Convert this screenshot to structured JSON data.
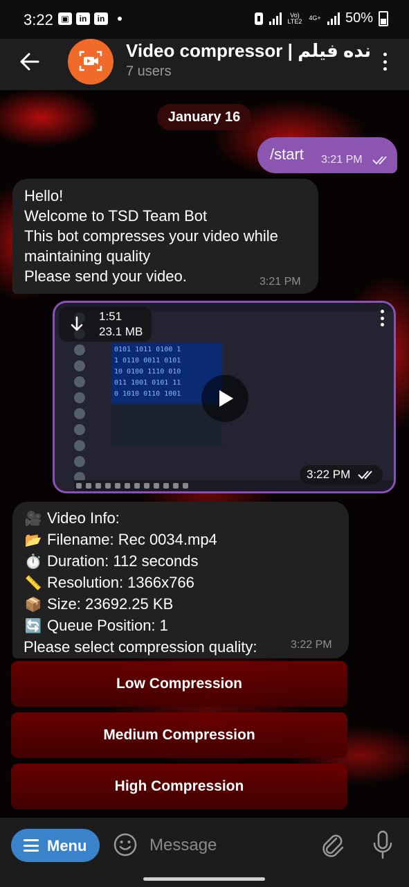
{
  "status_bar": {
    "time": "3:22",
    "network": "Vo) LTE2",
    "network_type": "4G+",
    "battery": "50%"
  },
  "header": {
    "title": "Video compressor | نده فیلم",
    "subtitle": "7 users"
  },
  "chat": {
    "date": "January 16",
    "outgoing": {
      "text": "/start",
      "time": "3:21 PM"
    },
    "welcome": {
      "lines": [
        "Hello!",
        "Welcome to TSD Team Bot",
        "This bot compresses your video while",
        "maintaining quality",
        "Please send your video."
      ],
      "time": "3:21 PM"
    },
    "video": {
      "duration": "1:51",
      "size": "23.1 MB",
      "time": "3:22 PM"
    },
    "info": {
      "rows": [
        {
          "icon": "🎥",
          "text": "Video Info:"
        },
        {
          "icon": "📂",
          "text": "Filename: Rec 0034.mp4"
        },
        {
          "icon": "⏱️",
          "text": "Duration: 112 seconds"
        },
        {
          "icon": "📏",
          "text": "Resolution: 1366x766"
        },
        {
          "icon": "📦",
          "text": "Size: 23692.25 KB"
        },
        {
          "icon": "🔄",
          "text": "Queue Position: 1"
        }
      ],
      "prompt": "Please select compression quality:",
      "time": "3:22 PM"
    }
  },
  "keyboard": {
    "low": "Low Compression",
    "medium": "Medium Compression",
    "high": "High Compression"
  },
  "input": {
    "menu_label": "Menu",
    "placeholder": "Message"
  }
}
